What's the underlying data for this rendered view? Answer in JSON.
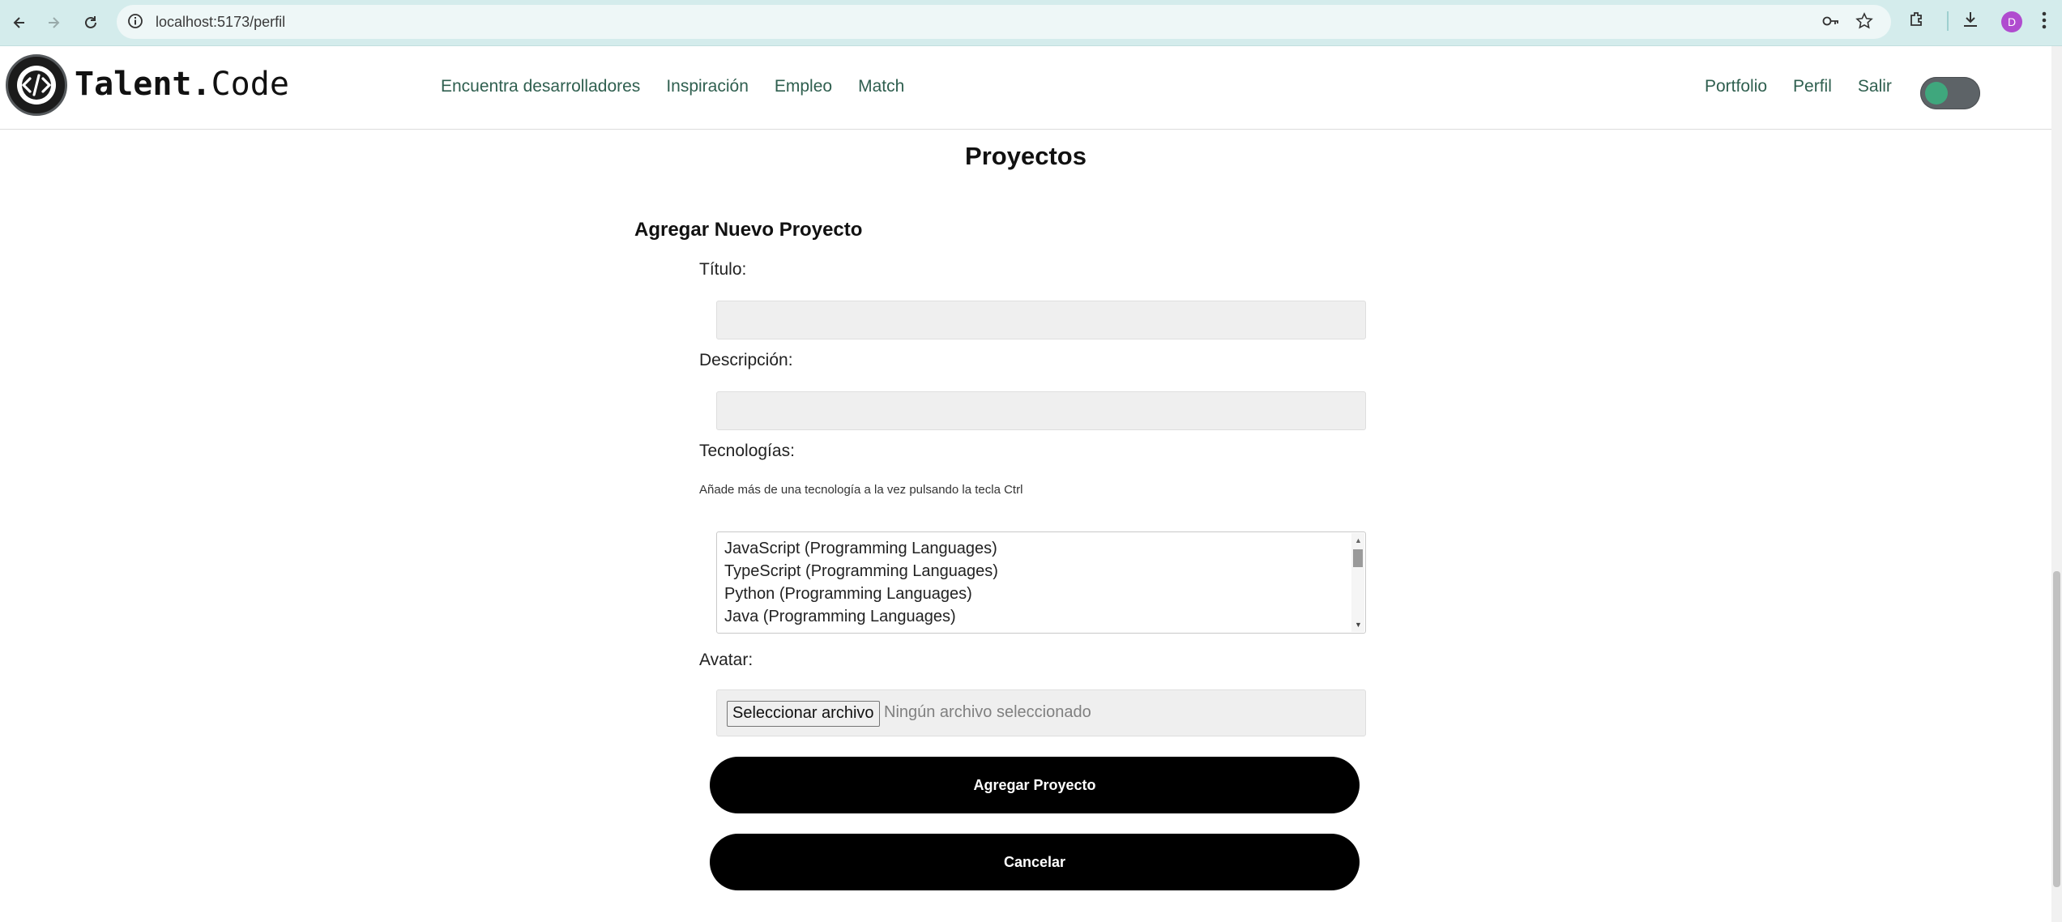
{
  "browser": {
    "url": "localhost:5173/perfil",
    "profile_initial": "D"
  },
  "header": {
    "logo_text_bold": "Talent.",
    "logo_text_regular": "Code",
    "main_nav": [
      "Encuentra desarrolladores",
      "Inspiración",
      "Empleo",
      "Match"
    ],
    "right_nav": [
      "Portfolio",
      "Perfil",
      "Salir"
    ],
    "theme_toggle": {
      "on": true,
      "accent": "#3fa77d"
    }
  },
  "page": {
    "section_title": "Proyectos",
    "form_title": "Agregar Nuevo Proyecto",
    "title_label": "Título:",
    "title_value": "",
    "description_label": "Descripción:",
    "description_value": "",
    "tech_label": "Tecnologías:",
    "tech_hint": "Añade más de una tecnología a la vez pulsando la tecla Ctrl",
    "tech_options": [
      "JavaScript (Programming Languages)",
      "TypeScript (Programming Languages)",
      "Python (Programming Languages)",
      "Java (Programming Languages)"
    ],
    "avatar_label": "Avatar:",
    "file_button": "Seleccionar archivo",
    "file_status": "Ningún archivo seleccionado",
    "submit_label": "Agregar Proyecto",
    "cancel_label": "Cancelar"
  }
}
